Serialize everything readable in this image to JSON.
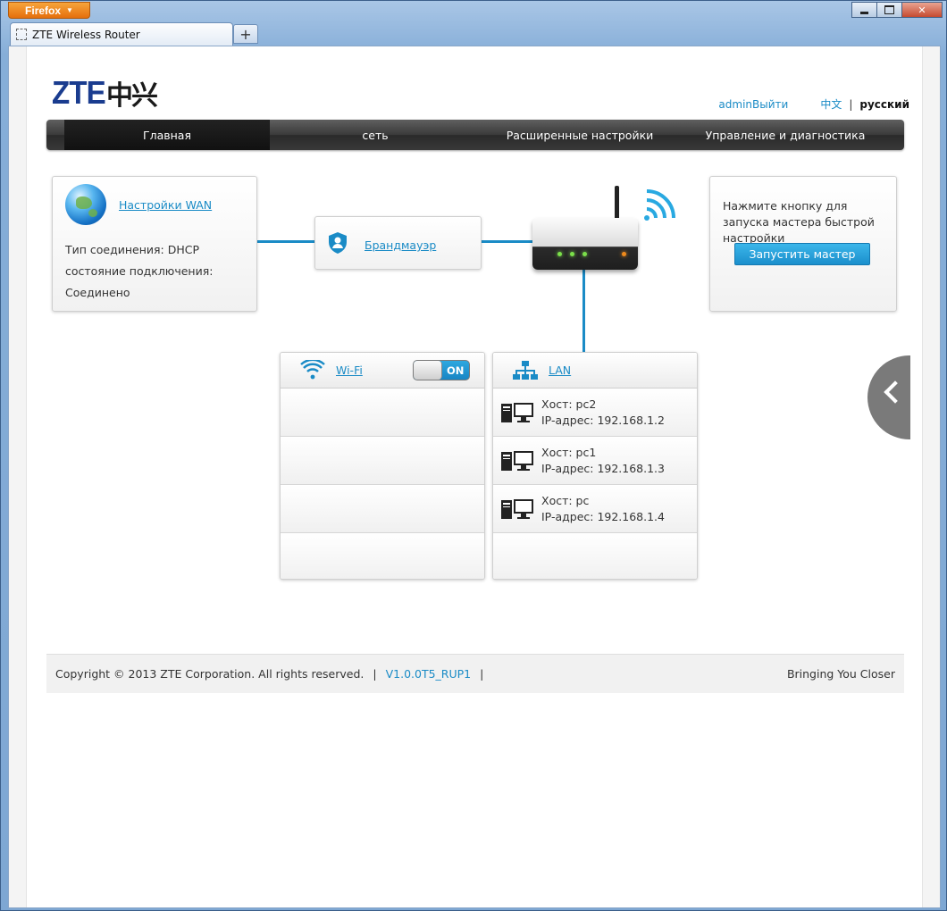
{
  "browser": {
    "app_button": "Firefox",
    "tab_title": "ZTE Wireless Router",
    "new_tab": "+"
  },
  "header": {
    "logo": "ZTE中兴",
    "user": "admin",
    "logout": "Выйти",
    "lang_cn": "中文",
    "lang_sep": "|",
    "lang_ru": "русский"
  },
  "nav": {
    "items": [
      "Главная",
      "сеть",
      "Расширенные настройки",
      "Управление и диагностика"
    ],
    "active": 0
  },
  "wan": {
    "title": "Настройки WAN",
    "lines": [
      "Тип соединения: DHCP",
      "состояние подключения:",
      "Соединено"
    ]
  },
  "firewall": {
    "title": "Брандмауэр"
  },
  "wizard": {
    "text": "Нажмите кнопку для запуска мастера быстрой настройки",
    "button": "Запустить мастер"
  },
  "wifi": {
    "title": "Wi-Fi",
    "toggle": "ON"
  },
  "lan": {
    "title": "LAN",
    "hosts": [
      {
        "host": "Хост: pc2",
        "ip": "IP-адрес: 192.168.1.2"
      },
      {
        "host": "Хост: pc1",
        "ip": "IP-адрес: 192.168.1.3"
      },
      {
        "host": "Хост: pc",
        "ip": "IP-адрес: 192.168.1.4"
      }
    ]
  },
  "footer": {
    "copyright": "Copyright © 2013 ZTE Corporation. All rights reserved.",
    "separator": "|",
    "version": "V1.0.0T5_RUP1",
    "tagline": "Bringing You Closer"
  },
  "colors": {
    "accent": "#1a8bc6",
    "navbar": "#3a3a3a",
    "wizard_button": "#1b8fcc"
  }
}
